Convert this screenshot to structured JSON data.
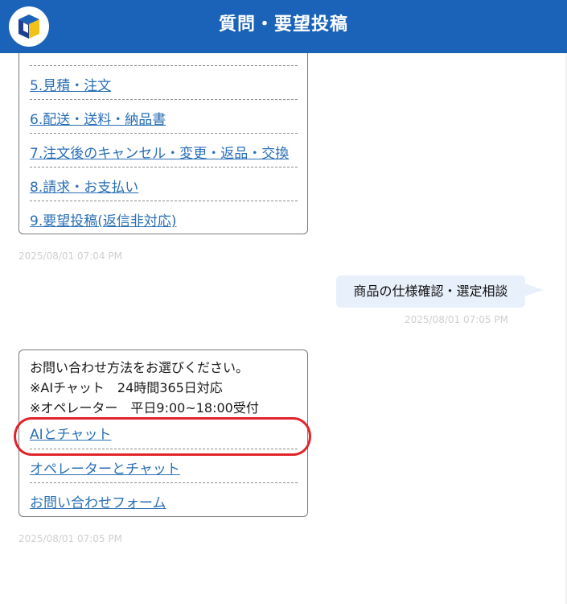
{
  "header": {
    "title": "質問・要望投稿",
    "brand_color": "#1a63b8"
  },
  "menu": {
    "items": [
      {
        "label": "5.見積・注文"
      },
      {
        "label": "6.配送・送料・納品書"
      },
      {
        "label": "7.注文後のキャンセル・変更・返品・交換"
      },
      {
        "label": "8.請求・お支払い"
      },
      {
        "label": "9.要望投稿(返信非対応)"
      }
    ],
    "timestamp": "2025/08/01 07:04 PM"
  },
  "user_message": {
    "text": "商品の仕様確認・選定相談",
    "timestamp": "2025/08/01 07:05 PM"
  },
  "options": {
    "intro": "お問い合わせ方法をお選びください。",
    "line_ai": "※AIチャット　24時間365日対応",
    "line_operator": "※オペレーター　平日9:00~18:00受付",
    "choices": [
      {
        "label": "AIとチャット"
      },
      {
        "label": "オペレーターとチャット"
      },
      {
        "label": "お問い合わせフォーム"
      }
    ],
    "timestamp": "2025/08/01 07:05 PM",
    "highlight_color": "#e0242b"
  }
}
